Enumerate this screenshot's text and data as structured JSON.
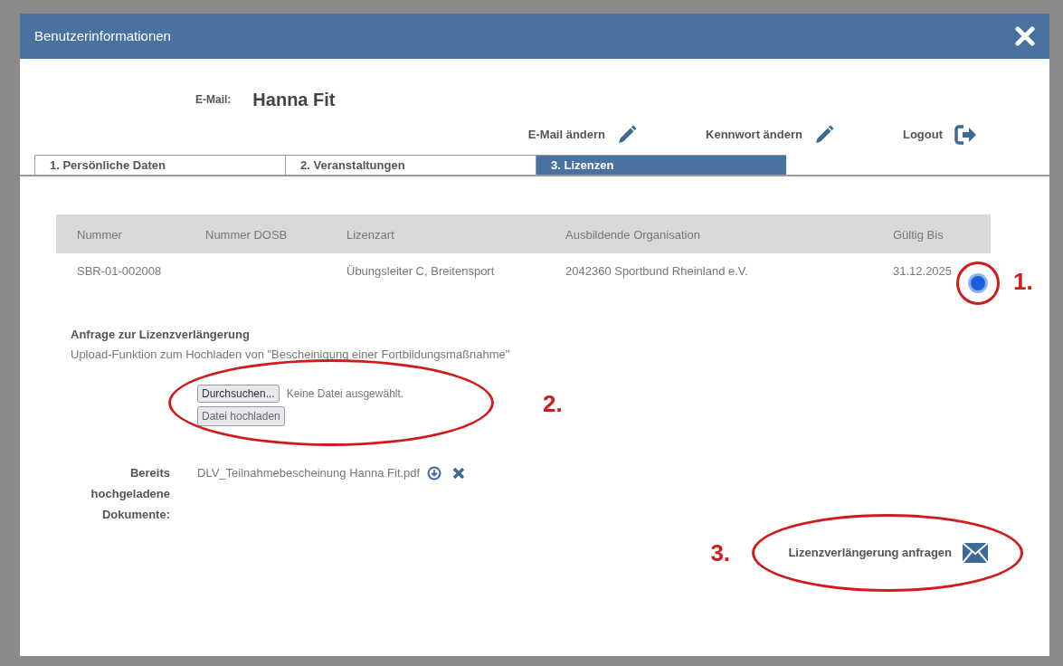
{
  "dialog": {
    "title": "Benutzerinformationen"
  },
  "user": {
    "label": "E-Mail:",
    "value": "Hanna Fit"
  },
  "actions": [
    {
      "label": "E-Mail ändern",
      "kind": "edit"
    },
    {
      "label": "Kennwort ändern",
      "kind": "edit"
    },
    {
      "label": "Logout",
      "kind": "logout"
    }
  ],
  "tabs": [
    {
      "label": "1. Persönliche Daten",
      "selected": false
    },
    {
      "label": "2. Veranstaltungen",
      "selected": false
    },
    {
      "label": "3. Lizenzen",
      "selected": true
    }
  ],
  "table": {
    "columns": [
      "Nummer",
      "Nummer DOSB",
      "Lizenzart",
      "Ausbildende Organisation",
      "Gültig Bis"
    ],
    "rows": [
      {
        "nummer": "SBR-01-002008",
        "lizenzart": "Übungsleiter C, Breitensport",
        "organisation": "2042360 Sportbund Rheinland e.V.",
        "gueltig_bis": "31.12.2025",
        "selected": true
      }
    ]
  },
  "renewal": {
    "heading": "Anfrage zur Lizenzverlängerung",
    "description": "Upload-Funktion zum Hochladen von \"Bescheinigung einer Fortbildungsmaßnahme\"",
    "browse_button": "Durchsuchen...",
    "file_status": "Keine Datei ausgewählt.",
    "upload_button": "Datei hochladen",
    "documents_label": "Bereits hochgeladene Dokumente:",
    "documents": [
      {
        "name": "DLV_Teilnahmebescheinung Hanna Fit.pdf"
      }
    ],
    "request_button": "Lizenzverlängerung anfragen"
  },
  "annotations": [
    {
      "label": "1."
    },
    {
      "label": "2."
    },
    {
      "label": "3."
    }
  ]
}
